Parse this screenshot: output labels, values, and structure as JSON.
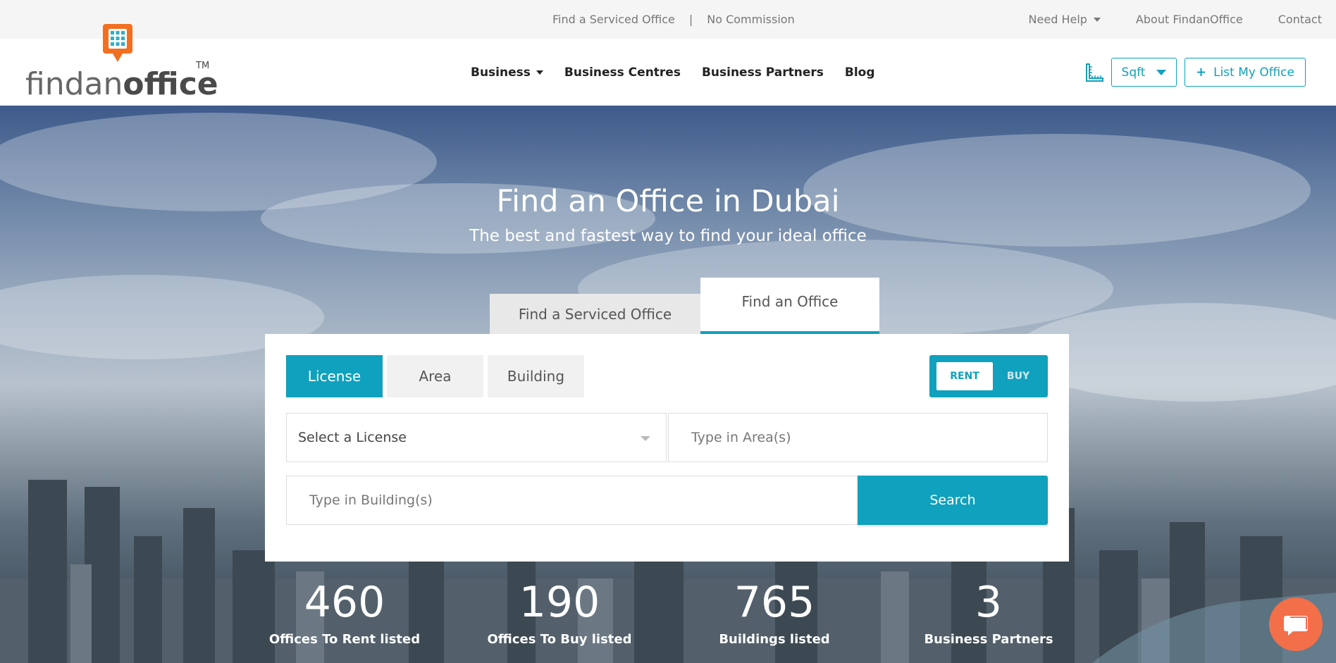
{
  "topbar": {
    "serviced_link": "Find a Serviced Office",
    "separator": "|",
    "commission_link": "No Commission",
    "need_help": "Need Help",
    "about": "About FindanOffice",
    "contact": "Contact"
  },
  "logo": {
    "text_light": "findan",
    "text_bold": "office",
    "tm": "TM"
  },
  "nav": {
    "items": [
      "Business",
      "Business Centres",
      "Business Partners",
      "Blog"
    ]
  },
  "header_right": {
    "unit": "Sqft",
    "list_office": "List My Office"
  },
  "hero": {
    "title": "Find an Office in Dubai",
    "subtitle": "The best and fastest way to find your ideal office",
    "tabs": [
      "Find a Serviced Office",
      "Find an Office"
    ],
    "active_tab": "Find an Office"
  },
  "search": {
    "type_tabs": [
      "License",
      "Area",
      "Building"
    ],
    "active_type": "License",
    "rent": "RENT",
    "buy": "BUY",
    "license_placeholder": "Select a License",
    "area_placeholder": "Type in Area(s)",
    "building_placeholder": "Type in Building(s)",
    "search_button": "Search"
  },
  "stats": [
    {
      "number": "460",
      "label": "Offices To Rent listed"
    },
    {
      "number": "190",
      "label": "Offices To Buy listed"
    },
    {
      "number": "765",
      "label": "Buildings listed"
    },
    {
      "number": "3",
      "label": "Business Partners"
    }
  ],
  "colors": {
    "accent": "#0fa1bd",
    "logo_orange": "#f26f21",
    "chat": "#f26f4a"
  }
}
